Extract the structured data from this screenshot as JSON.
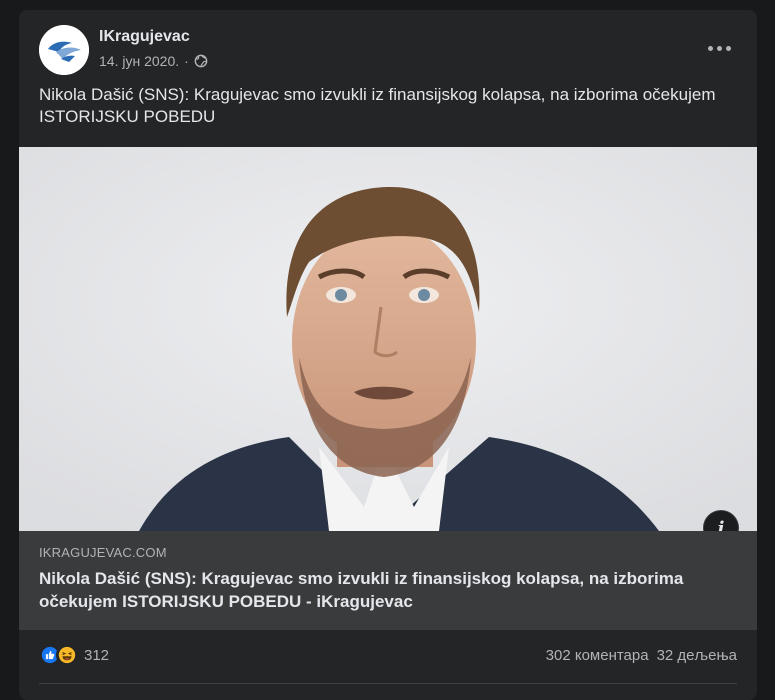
{
  "post": {
    "page_name": "IKragujevac",
    "date": "14. јун 2020.",
    "audience_icon": "globe-icon",
    "more_icon": "more-horizontal-icon",
    "text": "Nikola Dašić (SNS): Kragujevac smo izvukli iz finansijskog kolapsa, na izborima očekujem ISTORIJSKU POBEDU"
  },
  "link": {
    "domain": "IKRAGUJEVAC.COM",
    "title": "Nikola Dašić (SNS): Kragujevac smo izvukli iz finansijskog kolapsa, na izborima očekujem ISTORIJSKU POBEDU - iKragujevac",
    "info_icon": "info-icon"
  },
  "stats": {
    "reaction_icons": [
      "like-icon",
      "haha-icon"
    ],
    "reaction_count": "312",
    "comments": "302 коментара",
    "shares": "32 дељења"
  },
  "colors": {
    "background": "#18191a",
    "card": "#242526",
    "link_meta": "#3a3b3c",
    "primary_text": "#e4e6eb",
    "secondary_text": "#b0b3b8",
    "like_blue": "#1877f2",
    "haha_yellow": "#f7b928"
  }
}
